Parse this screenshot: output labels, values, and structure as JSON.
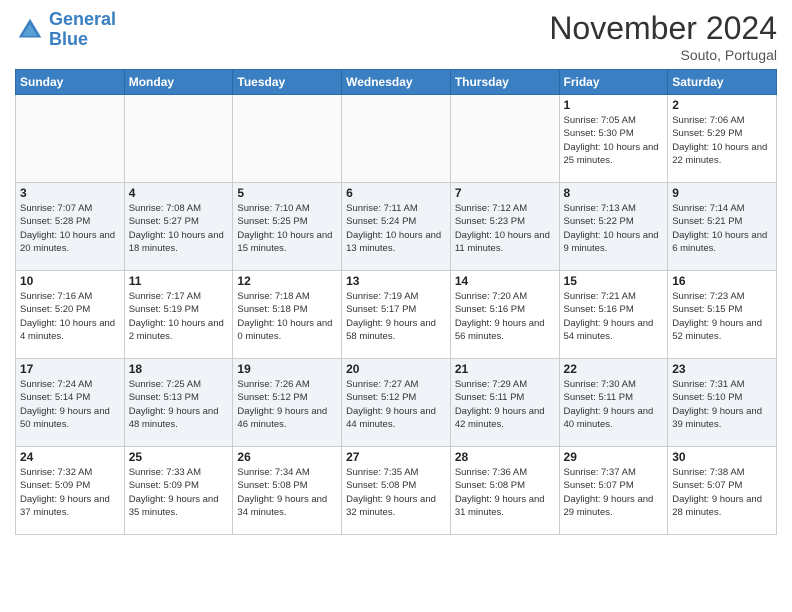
{
  "header": {
    "logo_line1": "General",
    "logo_line2": "Blue",
    "month": "November 2024",
    "location": "Souto, Portugal"
  },
  "weekdays": [
    "Sunday",
    "Monday",
    "Tuesday",
    "Wednesday",
    "Thursday",
    "Friday",
    "Saturday"
  ],
  "weeks": [
    [
      {
        "day": "",
        "info": ""
      },
      {
        "day": "",
        "info": ""
      },
      {
        "day": "",
        "info": ""
      },
      {
        "day": "",
        "info": ""
      },
      {
        "day": "",
        "info": ""
      },
      {
        "day": "1",
        "info": "Sunrise: 7:05 AM\nSunset: 5:30 PM\nDaylight: 10 hours and 25 minutes."
      },
      {
        "day": "2",
        "info": "Sunrise: 7:06 AM\nSunset: 5:29 PM\nDaylight: 10 hours and 22 minutes."
      }
    ],
    [
      {
        "day": "3",
        "info": "Sunrise: 7:07 AM\nSunset: 5:28 PM\nDaylight: 10 hours and 20 minutes."
      },
      {
        "day": "4",
        "info": "Sunrise: 7:08 AM\nSunset: 5:27 PM\nDaylight: 10 hours and 18 minutes."
      },
      {
        "day": "5",
        "info": "Sunrise: 7:10 AM\nSunset: 5:25 PM\nDaylight: 10 hours and 15 minutes."
      },
      {
        "day": "6",
        "info": "Sunrise: 7:11 AM\nSunset: 5:24 PM\nDaylight: 10 hours and 13 minutes."
      },
      {
        "day": "7",
        "info": "Sunrise: 7:12 AM\nSunset: 5:23 PM\nDaylight: 10 hours and 11 minutes."
      },
      {
        "day": "8",
        "info": "Sunrise: 7:13 AM\nSunset: 5:22 PM\nDaylight: 10 hours and 9 minutes."
      },
      {
        "day": "9",
        "info": "Sunrise: 7:14 AM\nSunset: 5:21 PM\nDaylight: 10 hours and 6 minutes."
      }
    ],
    [
      {
        "day": "10",
        "info": "Sunrise: 7:16 AM\nSunset: 5:20 PM\nDaylight: 10 hours and 4 minutes."
      },
      {
        "day": "11",
        "info": "Sunrise: 7:17 AM\nSunset: 5:19 PM\nDaylight: 10 hours and 2 minutes."
      },
      {
        "day": "12",
        "info": "Sunrise: 7:18 AM\nSunset: 5:18 PM\nDaylight: 10 hours and 0 minutes."
      },
      {
        "day": "13",
        "info": "Sunrise: 7:19 AM\nSunset: 5:17 PM\nDaylight: 9 hours and 58 minutes."
      },
      {
        "day": "14",
        "info": "Sunrise: 7:20 AM\nSunset: 5:16 PM\nDaylight: 9 hours and 56 minutes."
      },
      {
        "day": "15",
        "info": "Sunrise: 7:21 AM\nSunset: 5:16 PM\nDaylight: 9 hours and 54 minutes."
      },
      {
        "day": "16",
        "info": "Sunrise: 7:23 AM\nSunset: 5:15 PM\nDaylight: 9 hours and 52 minutes."
      }
    ],
    [
      {
        "day": "17",
        "info": "Sunrise: 7:24 AM\nSunset: 5:14 PM\nDaylight: 9 hours and 50 minutes."
      },
      {
        "day": "18",
        "info": "Sunrise: 7:25 AM\nSunset: 5:13 PM\nDaylight: 9 hours and 48 minutes."
      },
      {
        "day": "19",
        "info": "Sunrise: 7:26 AM\nSunset: 5:12 PM\nDaylight: 9 hours and 46 minutes."
      },
      {
        "day": "20",
        "info": "Sunrise: 7:27 AM\nSunset: 5:12 PM\nDaylight: 9 hours and 44 minutes."
      },
      {
        "day": "21",
        "info": "Sunrise: 7:29 AM\nSunset: 5:11 PM\nDaylight: 9 hours and 42 minutes."
      },
      {
        "day": "22",
        "info": "Sunrise: 7:30 AM\nSunset: 5:11 PM\nDaylight: 9 hours and 40 minutes."
      },
      {
        "day": "23",
        "info": "Sunrise: 7:31 AM\nSunset: 5:10 PM\nDaylight: 9 hours and 39 minutes."
      }
    ],
    [
      {
        "day": "24",
        "info": "Sunrise: 7:32 AM\nSunset: 5:09 PM\nDaylight: 9 hours and 37 minutes."
      },
      {
        "day": "25",
        "info": "Sunrise: 7:33 AM\nSunset: 5:09 PM\nDaylight: 9 hours and 35 minutes."
      },
      {
        "day": "26",
        "info": "Sunrise: 7:34 AM\nSunset: 5:08 PM\nDaylight: 9 hours and 34 minutes."
      },
      {
        "day": "27",
        "info": "Sunrise: 7:35 AM\nSunset: 5:08 PM\nDaylight: 9 hours and 32 minutes."
      },
      {
        "day": "28",
        "info": "Sunrise: 7:36 AM\nSunset: 5:08 PM\nDaylight: 9 hours and 31 minutes."
      },
      {
        "day": "29",
        "info": "Sunrise: 7:37 AM\nSunset: 5:07 PM\nDaylight: 9 hours and 29 minutes."
      },
      {
        "day": "30",
        "info": "Sunrise: 7:38 AM\nSunset: 5:07 PM\nDaylight: 9 hours and 28 minutes."
      }
    ]
  ]
}
